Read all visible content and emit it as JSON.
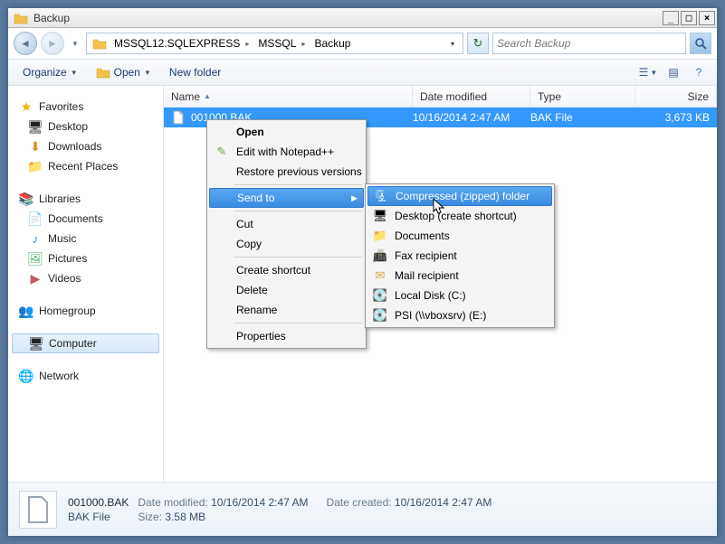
{
  "window": {
    "title": "Backup"
  },
  "address": {
    "segments": [
      "MSSQL12.SQLEXPRESS",
      "MSSQL",
      "Backup"
    ]
  },
  "search": {
    "placeholder": "Search Backup"
  },
  "toolbar": {
    "organize": "Organize",
    "open": "Open",
    "newfolder": "New folder"
  },
  "sidebar": {
    "favorites": {
      "label": "Favorites",
      "items": [
        "Desktop",
        "Downloads",
        "Recent Places"
      ]
    },
    "libraries": {
      "label": "Libraries",
      "items": [
        "Documents",
        "Music",
        "Pictures",
        "Videos"
      ]
    },
    "homegroup": {
      "label": "Homegroup"
    },
    "computer": {
      "label": "Computer"
    },
    "network": {
      "label": "Network"
    }
  },
  "columns": {
    "name": "Name",
    "date": "Date modified",
    "type": "Type",
    "size": "Size"
  },
  "files": [
    {
      "name": "001000.BAK",
      "date": "10/16/2014 2:47 AM",
      "type": "BAK File",
      "size": "3,673 KB"
    }
  ],
  "context_menu": {
    "open": "Open",
    "edit_npp": "Edit with Notepad++",
    "restore": "Restore previous versions",
    "sendto": "Send to",
    "cut": "Cut",
    "copy": "Copy",
    "create_shortcut": "Create shortcut",
    "delete": "Delete",
    "rename": "Rename",
    "properties": "Properties"
  },
  "sendto_menu": {
    "compressed": "Compressed (zipped) folder",
    "desktop": "Desktop (create shortcut)",
    "documents": "Documents",
    "fax": "Fax recipient",
    "mail": "Mail recipient",
    "localc": "Local Disk (C:)",
    "psie": "PSI (\\\\vboxsrv) (E:)"
  },
  "details": {
    "filename": "001000.BAK",
    "filetype": "BAK File",
    "date_modified_label": "Date modified:",
    "date_modified": "10/16/2014 2:47 AM",
    "size_label": "Size:",
    "size": "3.58 MB",
    "date_created_label": "Date created:",
    "date_created": "10/16/2014 2:47 AM"
  }
}
